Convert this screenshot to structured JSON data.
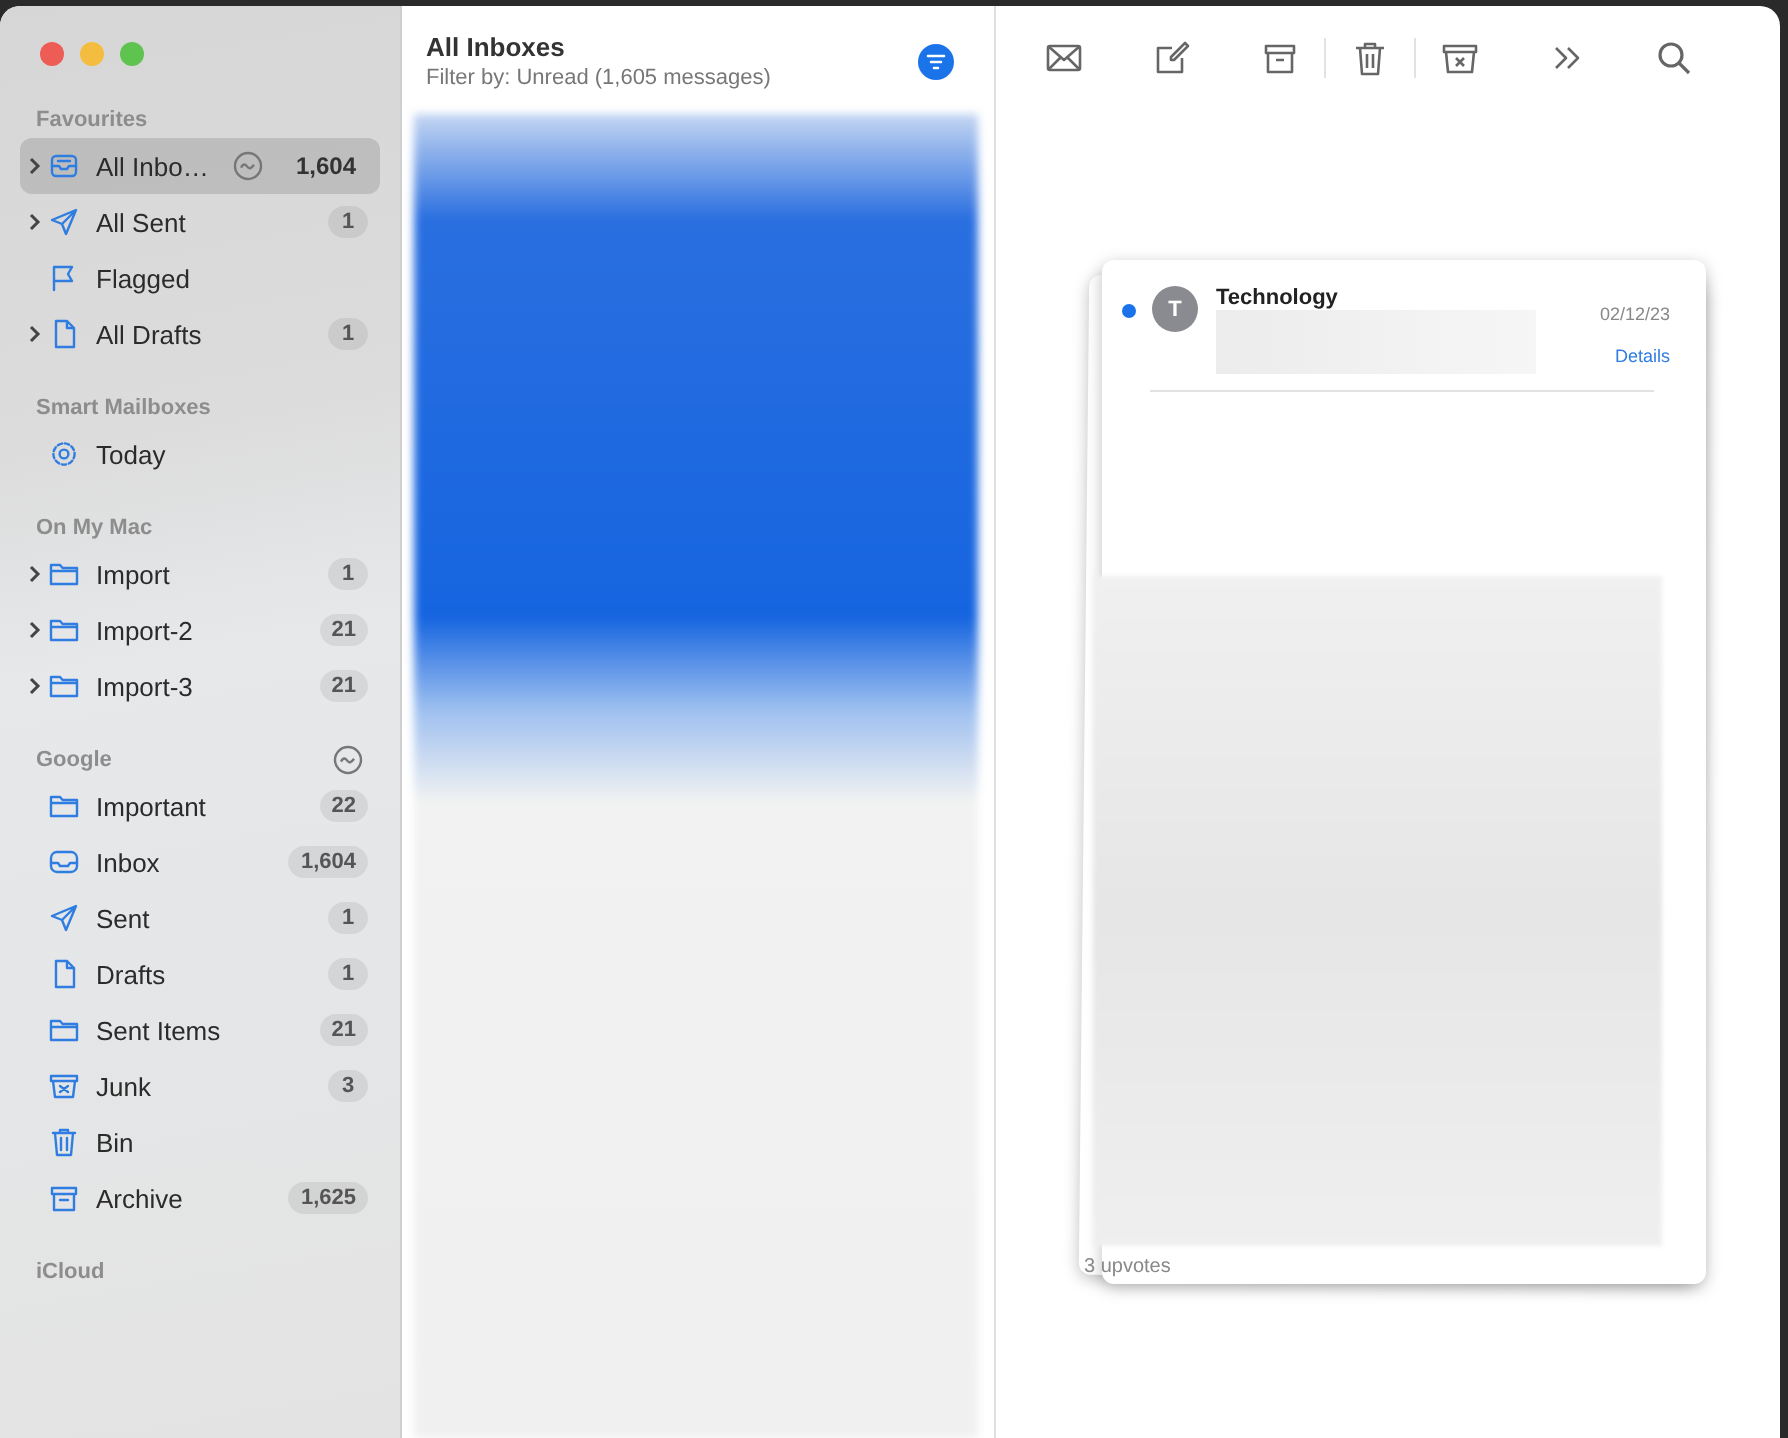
{
  "sidebar": {
    "sections": [
      {
        "title": "Favourites",
        "items": [
          {
            "label": "All Inbo…",
            "kind": "tray",
            "expandable": true,
            "selected": true,
            "activity": true,
            "count": "1,604"
          },
          {
            "label": "All Sent",
            "kind": "send",
            "expandable": true,
            "selected": false,
            "count": "1"
          },
          {
            "label": "Flagged",
            "kind": "flag",
            "selected": false
          },
          {
            "label": "All Drafts",
            "kind": "doc",
            "expandable": true,
            "selected": false,
            "count": "1"
          }
        ]
      },
      {
        "title": "Smart Mailboxes",
        "items": [
          {
            "label": "Today",
            "kind": "gear",
            "selected": false
          }
        ]
      },
      {
        "title": "On My Mac",
        "items": [
          {
            "label": "Import",
            "kind": "folder",
            "expandable": true,
            "selected": false,
            "count": "1"
          },
          {
            "label": "Import-2",
            "kind": "folder",
            "expandable": true,
            "selected": false,
            "count": "21"
          },
          {
            "label": "Import-3",
            "kind": "folder",
            "expandable": true,
            "selected": false,
            "count": "21"
          }
        ]
      },
      {
        "title": "Google",
        "activity": true,
        "items": [
          {
            "label": "Important",
            "kind": "folder",
            "selected": false,
            "count": "22"
          },
          {
            "label": "Inbox",
            "kind": "inbox",
            "selected": false,
            "count": "1,604"
          },
          {
            "label": "Sent",
            "kind": "send",
            "selected": false,
            "count": "1"
          },
          {
            "label": "Drafts",
            "kind": "doc",
            "selected": false,
            "count": "1"
          },
          {
            "label": "Sent Items",
            "kind": "folder",
            "selected": false,
            "count": "21"
          },
          {
            "label": "Junk",
            "kind": "junk",
            "selected": false,
            "count": "3"
          },
          {
            "label": "Bin",
            "kind": "bin",
            "selected": false
          },
          {
            "label": "Archive",
            "kind": "archive",
            "selected": false,
            "count": "1,625"
          }
        ]
      },
      {
        "title": "iCloud"
      }
    ]
  },
  "message_list": {
    "title": "All Inboxes",
    "subtitle": "Filter by: Unread (1,605 messages)",
    "filter_on": true
  },
  "reader": {
    "message": {
      "sender": "Technology",
      "initial": "T",
      "date": "02/12/23",
      "link": "Details",
      "unread": true,
      "footer": "3 upvotes"
    }
  }
}
